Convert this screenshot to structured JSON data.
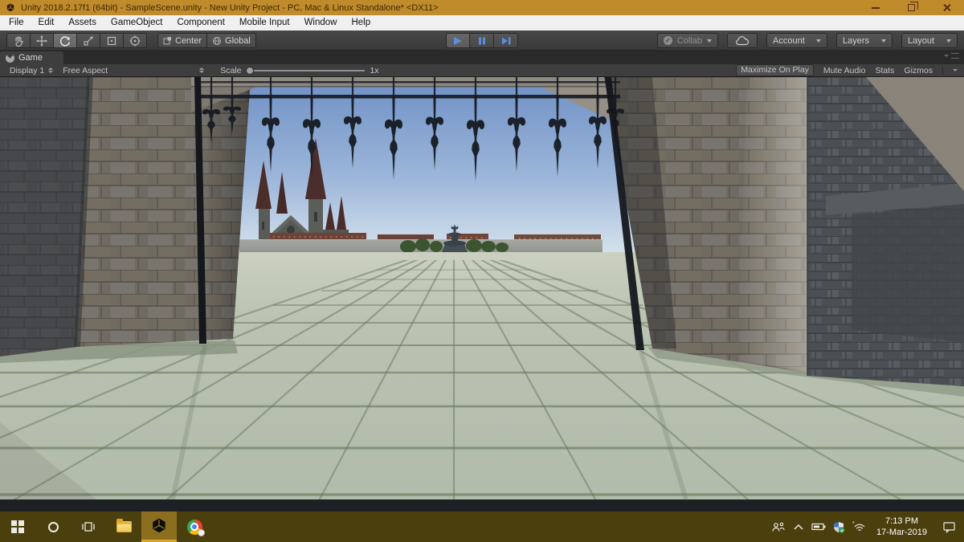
{
  "window": {
    "title": "Unity 2018.2.17f1 (64bit) - SampleScene.unity - New Unity Project - PC, Mac & Linux Standalone* <DX11>"
  },
  "menu_bar": {
    "items": [
      "File",
      "Edit",
      "Assets",
      "GameObject",
      "Component",
      "Mobile Input",
      "Window",
      "Help"
    ]
  },
  "toolbar": {
    "tools": [
      "hand-tool",
      "move-tool",
      "rotate-tool",
      "scale-tool",
      "rect-tool",
      "transform-tool"
    ],
    "active_tool": "rotate-tool",
    "pivot_label": "Center",
    "orientation_label": "Global",
    "collab_label": "Collab",
    "account_label": "Account",
    "layers_label": "Layers",
    "layout_label": "Layout"
  },
  "game_panel": {
    "tab_label": "Game",
    "display_selector": "Display 1",
    "aspect_selector": "Free Aspect",
    "scale_label": "Scale",
    "scale_value": "1x",
    "toggles": {
      "maximize_on_play": "Maximize On Play",
      "mute_audio": "Mute Audio",
      "stats": "Stats",
      "gizmos": "Gizmos"
    }
  },
  "scene": {
    "colors": {
      "sky_top": "#6f90c5",
      "sky_horizon": "#dde8ef",
      "floor": "#b5bfae",
      "moss_joint": "#66775a",
      "stone_front": "#6f6a62",
      "stone_shadow": "#45474a",
      "iron_gate": "#161b23",
      "cathedral_spire": "#4b2d2b",
      "distant_wall": "#979a95",
      "brick_buildings": "#6f4238",
      "trees": "#3c5530"
    }
  },
  "taskbar": {
    "clock_time": "7:13 PM",
    "clock_date": "17-Mar-2019"
  }
}
